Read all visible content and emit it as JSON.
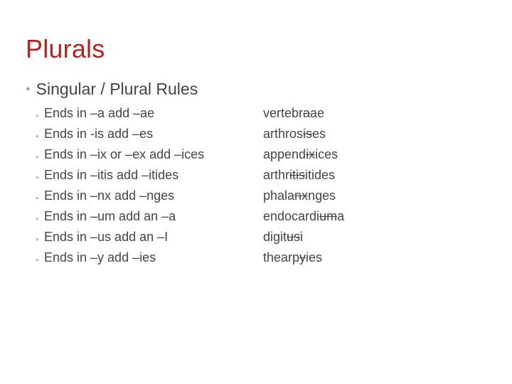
{
  "title": "Plurals",
  "subtitle": "Singular / Plural Rules",
  "rules": [
    {
      "text": "Ends in –a add –ae",
      "ex_pre": "vertebr",
      "ex_strike": "a",
      "ex_post": "ae"
    },
    {
      "text": "Ends in  -is add –es",
      "ex_pre": " arthros",
      "ex_strike": "is",
      "ex_post": "es"
    },
    {
      "text": "Ends in –ix or –ex  add –ices",
      "ex_pre": "append",
      "ex_strike": "ix",
      "ex_post": "ices"
    },
    {
      "text": "Ends in –itis  add –itides",
      "ex_pre": "arthr",
      "ex_strike": "itis",
      "ex_post": "itides"
    },
    {
      "text": "Ends in –nx  add –nges",
      "ex_pre": " phala",
      "ex_strike": "nx",
      "ex_post": "nges"
    },
    {
      "text": "Ends in –um add an –a",
      "ex_pre": "endocardi",
      "ex_strike": "um",
      "ex_post": "a"
    },
    {
      "text": "Ends in –us add an –I",
      "ex_pre": "digit",
      "ex_strike": "us",
      "ex_post": "i"
    },
    {
      "text": "Ends in –y add –ies",
      "ex_pre": " thearp",
      "ex_strike": "y",
      "ex_post": "ies"
    }
  ]
}
